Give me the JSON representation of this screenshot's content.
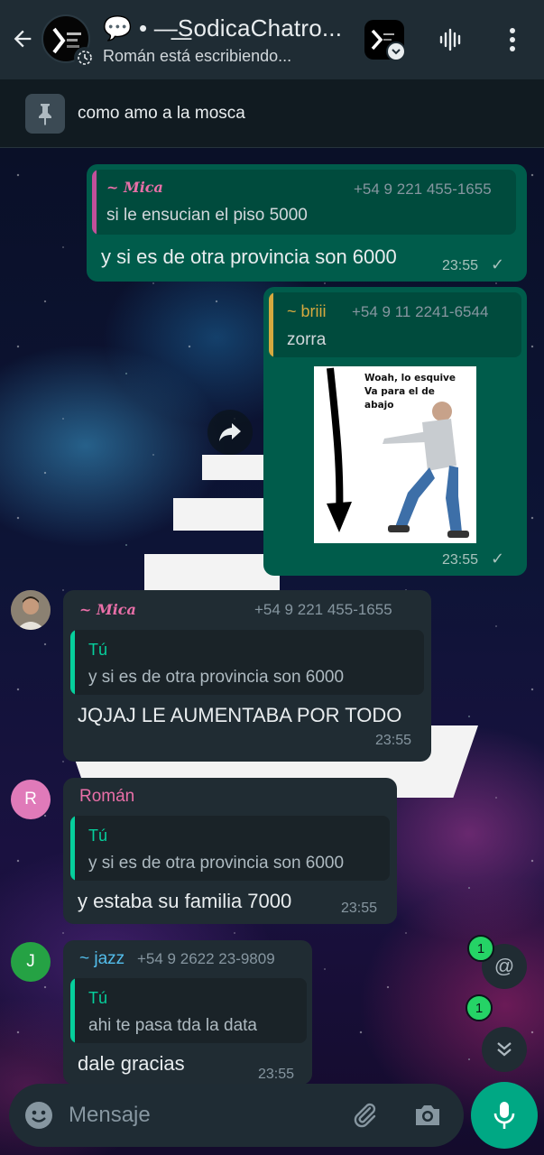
{
  "header": {
    "title": "💬 • —͟͟SodicaChatro...",
    "subtitle": "Román está escribiendo..."
  },
  "pinned": {
    "text": "como amo a la mosca"
  },
  "messages": [
    {
      "type": "outgoing",
      "quote": {
        "name": "~ 𝑴𝒊𝒄𝒂",
        "phone": "+54 9 221 455-1655",
        "text": "si le ensucian el piso 5000",
        "bar_color": "#c2509b"
      },
      "text": "y si es de otra provincia son 6000",
      "time": "23:55"
    },
    {
      "type": "outgoing",
      "quote": {
        "name": "~ briii",
        "phone": "+54 9 11 2241-6544",
        "text": "zorra",
        "bar_color": "#d6a93f"
      },
      "image": {
        "caption": "Woah, lo esquive\nVa para el de\nabajo"
      },
      "time": "23:55"
    },
    {
      "type": "incoming",
      "sender": "~ 𝑴𝒊𝒄𝒂",
      "phone": "+54 9 221 455-1655",
      "quote": {
        "name": "Tú",
        "text": "y si es de otra provincia son 6000",
        "bar_color": "#06cf9c"
      },
      "text": "JQJAJ LE AUMENTABA POR TODO",
      "time": "23:55"
    },
    {
      "type": "incoming",
      "sender": "Román",
      "avatar_letter": "R",
      "quote": {
        "name": "Tú",
        "text": "y si es de otra provincia son 6000",
        "bar_color": "#06cf9c"
      },
      "text": "y estaba su familia 7000",
      "time": "23:55"
    },
    {
      "type": "incoming",
      "sender": "~ jazz",
      "phone": "+54 9 2622 23-9809",
      "avatar_letter": "J",
      "quote": {
        "name": "Tú",
        "text": "ahi te pasa tda la data",
        "bar_color": "#06cf9c"
      },
      "text": "dale gracias",
      "time": "23:55"
    }
  ],
  "floating": {
    "mention_count": "1",
    "mention_symbol": "@",
    "unread_count": "1",
    "scroll_symbol": "⌄⌄"
  },
  "composer": {
    "placeholder": "Mensaje"
  },
  "colors": {
    "header_bg": "#1f2c34",
    "outgoing_bubble": "#005c4b",
    "incoming_bubble": "#202c33",
    "accent": "#00a884",
    "mica_name": "#e96fa8",
    "roman_name": "#e96fa8",
    "jazz_name": "#53bdeb",
    "tu_name": "#06cf9c"
  },
  "icons": [
    "back-arrow-icon",
    "status-icon",
    "community-icon",
    "voice-chat-icon",
    "menu-icon",
    "pin-icon",
    "forward-icon",
    "emoji-icon",
    "attach-icon",
    "camera-icon",
    "mic-icon"
  ]
}
